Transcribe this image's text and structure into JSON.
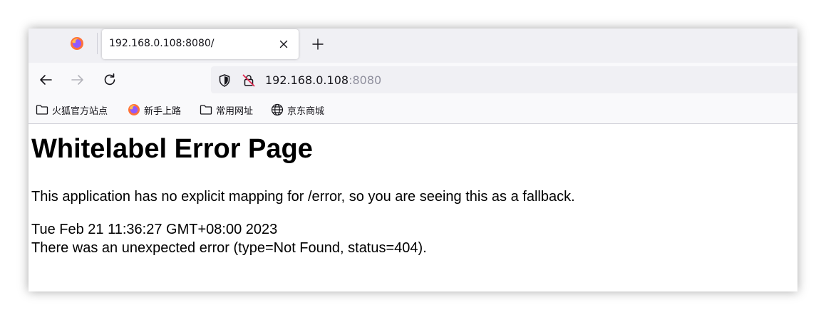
{
  "browser": {
    "tab": {
      "title": "192.168.0.108:8080/",
      "favicon": "firefox-icon"
    },
    "urlbar": {
      "host": "192.168.0.108",
      "port": ":8080"
    },
    "bookmarks": [
      {
        "label": "火狐官方站点",
        "icon": "folder-icon"
      },
      {
        "label": "新手上路",
        "icon": "firefox-icon"
      },
      {
        "label": "常用网址",
        "icon": "folder-icon"
      },
      {
        "label": "京东商城",
        "icon": "globe-icon"
      }
    ]
  },
  "page": {
    "heading": "Whitelabel Error Page",
    "message": "This application has no explicit mapping for /error, so you are seeing this as a fallback.",
    "timestamp": "Tue Feb 21 11:36:27 GMT+08:00 2023",
    "error": "There was an unexpected error (type=Not Found, status=404)."
  },
  "colors": {
    "tabstrip": "#f0f0f4",
    "toolbar": "#f9f9fb",
    "urlbar": "#f0f0f4",
    "port_text": "#8f8f9d"
  }
}
